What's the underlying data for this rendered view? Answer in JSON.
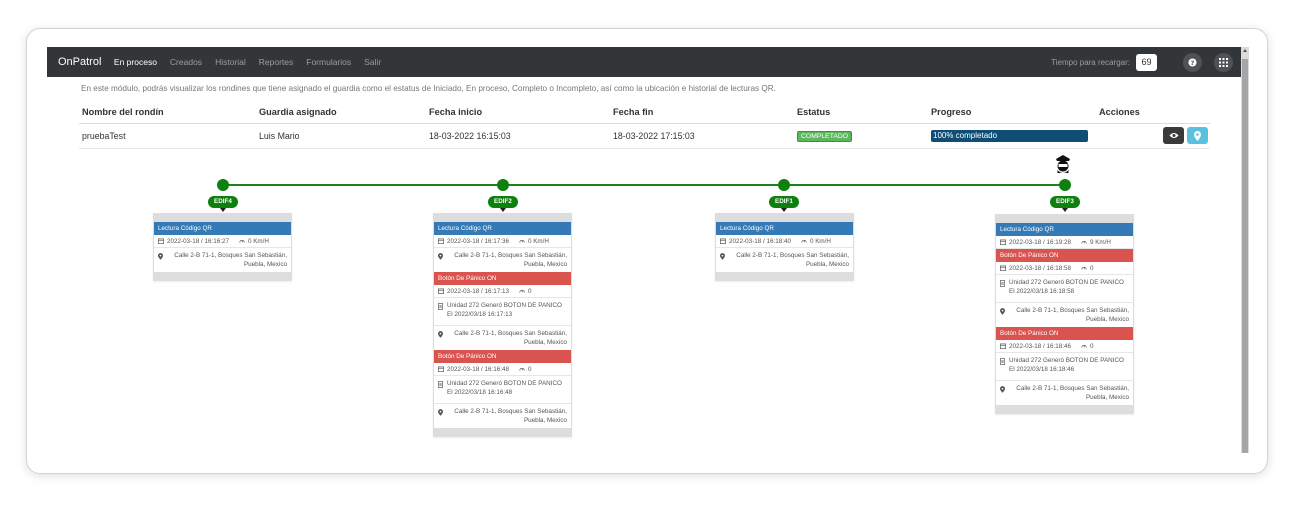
{
  "navbar": {
    "brand": "OnPatrol",
    "links": [
      "En proceso",
      "Creados",
      "Historial",
      "Reportes",
      "Formularios",
      "Salir"
    ],
    "reload_label": "Tiempo para recargar:",
    "reload_count": "69"
  },
  "description": "En este módulo, podrás visualizar los rondines que tiene asignado el guardia como el estatus de Iniciado, En proceso, Completo o Incompleto, así como la ubicación e historial de lecturas QR.",
  "table": {
    "headers": [
      "Nombre del rondín",
      "Guardia asignado",
      "Fecha inicio",
      "Fecha fin",
      "Estatus",
      "Progreso",
      "Acciones"
    ],
    "row": {
      "name": "pruebaTest",
      "guard": "Luis Mario",
      "start": "18-03-2022 16:15:03",
      "end": "18-03-2022 17:15:03",
      "status": "COMPLETADO",
      "progress_text": "100% completado",
      "progress_value": 100
    }
  },
  "colors": {
    "navbar": "#323639",
    "line": "#0d800d",
    "blue": "#337ab7",
    "red": "#d9534f"
  },
  "checkpoints": [
    {
      "label": "EDIF4",
      "events": [
        {
          "type": "qr",
          "title": "Lectura Código QR",
          "datetime": "2022-03-18 / 16:16:27",
          "speed": "0 Km/H",
          "address": "Calle 2-B 71-1, Bosques San Sebastián, Puebla, Mexico"
        }
      ]
    },
    {
      "label": "EDIF2",
      "events": [
        {
          "type": "qr",
          "title": "Lectura Código QR",
          "datetime": "2022-03-18 / 16:17:36",
          "speed": "0 Km/H",
          "address": "Calle 2-B 71-1, Bosques San Sebastián, Puebla, Mexico"
        },
        {
          "type": "panic",
          "title": "Botón De Pánico ON",
          "datetime": "2022-03-18 / 16:17:13",
          "speed": "0",
          "message": "Unidad 272 Generó BOTON DE PANICO El 2022/03/18 16:17:13",
          "address": "Calle 2-B 71-1, Bosques San Sebastián, Puebla, Mexico"
        },
        {
          "type": "panic",
          "title": "Botón De Pánico ON",
          "datetime": "2022-03-18 / 16:16:48",
          "speed": "0",
          "message": "Unidad 272 Generó BOTON DE PANICO El 2022/03/18 16:16:48",
          "address": "Calle 2-B 71-1, Bosques San Sebastián, Puebla, Mexico"
        }
      ]
    },
    {
      "label": "EDIF1",
      "events": [
        {
          "type": "qr",
          "title": "Lectura Código QR",
          "datetime": "2022-03-18 / 16:18:40",
          "speed": "0 Km/H",
          "address": "Calle 2-B 71-1, Bosques San Sebastián, Puebla, Mexico"
        }
      ]
    },
    {
      "label": "EDIF3",
      "events": [
        {
          "type": "qr",
          "title": "Lectura Código QR",
          "datetime": "2022-03-18 / 16:19:28",
          "speed": "9 Km/H"
        },
        {
          "type": "panic",
          "title": "Botón De Pánico ON",
          "datetime": "2022-03-18 / 16:18:58",
          "speed": "0",
          "message": "Unidad 272 Generó BOTON DE PANICO El 2022/03/18 16:18:58",
          "address": "Calle 2-B 71-1, Bosques San Sebastián, Puebla, Mexico"
        },
        {
          "type": "panic",
          "title": "Botón De Pánico ON",
          "datetime": "2022-03-18 / 16:18:46",
          "speed": "0",
          "message": "Unidad 272 Generó BOTON DE PANICO El 2022/03/18 16:18:46",
          "address": "Calle 2-B 71-1, Bosques San Sebastián, Puebla, Mexico"
        }
      ]
    }
  ]
}
